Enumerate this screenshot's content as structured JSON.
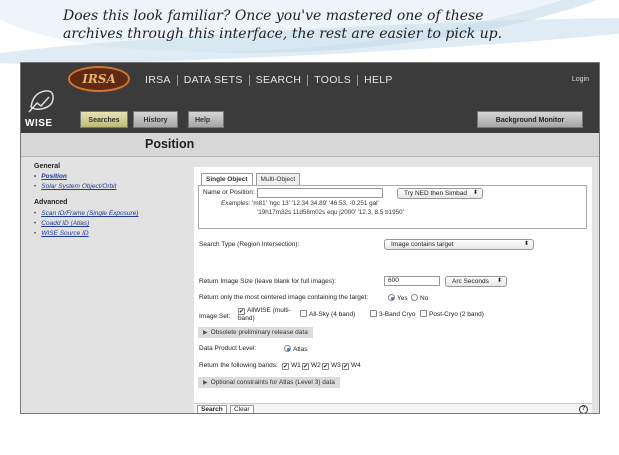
{
  "slide": {
    "caption": "Does this look familiar? Once you've mastered one of these archives through this interface, the rest are easier to pick up."
  },
  "header": {
    "logo_text": "IRSA",
    "mission_label": "WISE",
    "main_nav": [
      "IRSA",
      "DATA SETS",
      "SEARCH",
      "TOOLS",
      "HELP"
    ],
    "login": "Login",
    "sub_nav": {
      "searches": "Searches",
      "history": "History",
      "help": "Help"
    },
    "background_monitor": "Background Monitor"
  },
  "page_title": "Position",
  "sidebar": {
    "general_heading": "General",
    "general_items": [
      "Position",
      "Solar System Object/Orbit"
    ],
    "advanced_heading": "Advanced",
    "advanced_items": [
      "Scan ID/Frame (Single Exposure)",
      "Coadd ID (Atlas)",
      "WISE Source ID"
    ]
  },
  "form": {
    "tabs": [
      "Single Object",
      "Multi-Object"
    ],
    "name_label": "Name or Position:",
    "name_value": "",
    "resolver": "Try NED then Simbad",
    "examples_label": "Examples:",
    "examples_line1": "'m81'   'ngc 13'   '12.34 34.89'   '46.53, -0.251 gal'",
    "examples_line2": "'19h17m32s 11d58m02s equ j2000'   '12.3, 8.5 b1950'",
    "search_type_label": "Search Type (Region Intersection):",
    "search_type_value": "Image contains target",
    "image_size_label": "Return Image Size (leave blank for full images):",
    "image_size_value": "600",
    "image_size_unit": "Arc Seconds",
    "centered_label": "Return only the most centered image containing the target:",
    "centered_yes": "Yes",
    "centered_no": "No",
    "image_set_label": "Image Set:",
    "image_set_options": [
      "AllWISE (multi-band)",
      "All-Sky (4 band)",
      "3-Band Cryo",
      "Post-Cryo (2 band)"
    ],
    "obsolete_bar": "Obsolete preliminary release data",
    "product_level_label": "Data Product Level:",
    "product_level_value": "Atlas",
    "bands_label": "Return the following bands:",
    "bands": [
      "W1",
      "W2",
      "W3",
      "W4"
    ],
    "optional_bar": "Optional constraints for Atlas (Level 3) data",
    "search_button": "Search",
    "clear_button": "Clear"
  }
}
